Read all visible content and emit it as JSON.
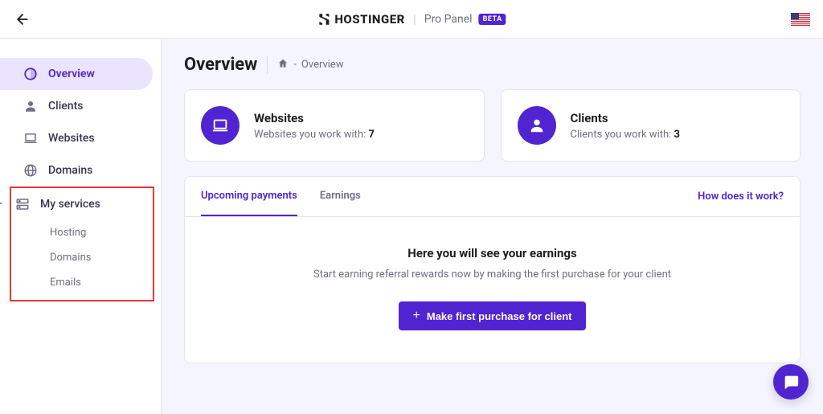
{
  "header": {
    "brand_name": "HOSTINGER",
    "brand_sub": "Pro Panel",
    "badge": "BETA"
  },
  "sidebar": {
    "items": [
      {
        "label": "Overview"
      },
      {
        "label": "Clients"
      },
      {
        "label": "Websites"
      },
      {
        "label": "Domains"
      },
      {
        "label": "My services"
      }
    ],
    "sub_items": [
      {
        "label": "Hosting"
      },
      {
        "label": "Domains"
      },
      {
        "label": "Emails"
      }
    ]
  },
  "page": {
    "title": "Overview",
    "breadcrumb_sep": "-",
    "breadcrumb_current": "Overview"
  },
  "cards": {
    "websites": {
      "title": "Websites",
      "subtext": "Websites you work with: ",
      "count": "7"
    },
    "clients": {
      "title": "Clients",
      "subtext": "Clients you work with: ",
      "count": "3"
    }
  },
  "panel": {
    "tabs": [
      {
        "label": "Upcoming payments"
      },
      {
        "label": "Earnings"
      }
    ],
    "help_link": "How does it work?",
    "empty_title": "Here you will see your earnings",
    "empty_sub": "Start earning referral rewards now by making the first purchase for your client",
    "cta_label": "Make first purchase for client"
  }
}
